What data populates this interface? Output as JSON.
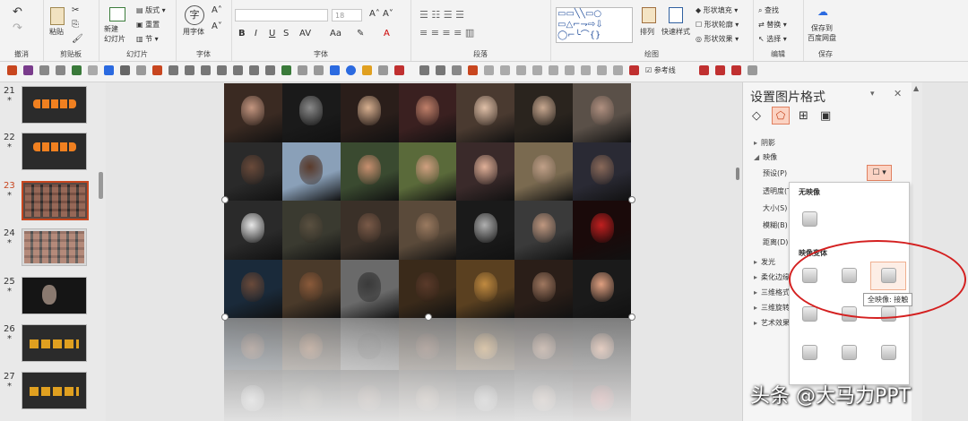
{
  "ribbon": {
    "undo_group": "撤消",
    "clipboard": {
      "label": "剪贴板",
      "paste": "粘贴"
    },
    "slides": {
      "label": "幻灯片",
      "new_slide": "新建\n幻灯片",
      "layout": "版式",
      "reset": "重置",
      "section": "节"
    },
    "font": {
      "label": "字体",
      "use_font": "用字体",
      "font_size": "18"
    },
    "paragraph": {
      "label": "段落"
    },
    "drawing": {
      "label": "绘图",
      "arrange": "排列",
      "quick_styles": "快速样式",
      "shape_fill": "形状填充",
      "shape_outline": "形状轮廓",
      "shape_effects": "形状效果"
    },
    "editing": {
      "label": "编辑",
      "find": "查找",
      "replace": "替换",
      "select": "选择"
    },
    "save": {
      "label": "保存",
      "save_to_cloud": "保存到\n百度网盘"
    }
  },
  "qat": {
    "guides_label": "参考线"
  },
  "slide_list": [
    {
      "num": "21",
      "star": "*"
    },
    {
      "num": "22",
      "star": "*"
    },
    {
      "num": "23",
      "star": "*",
      "selected": true
    },
    {
      "num": "24",
      "star": "*"
    },
    {
      "num": "25",
      "star": "*"
    },
    {
      "num": "26",
      "star": "*"
    },
    {
      "num": "27",
      "star": "*"
    }
  ],
  "pane": {
    "title": "设置图片格式",
    "sections": {
      "shadow": "阴影",
      "reflection": "映像",
      "preset": "预设(P)",
      "transparency": "透明度(T)",
      "size": "大小(S)",
      "blur": "模糊(B)",
      "distance": "距离(D)",
      "glow": "发光",
      "soft_edges": "柔化边缘",
      "three_d_format": "三维格式",
      "three_d_rotation": "三维旋转",
      "artistic_effects": "艺术效果"
    }
  },
  "reflection_dropdown": {
    "no_reflection": "无映像",
    "variations": "映像变体",
    "tooltip": "全映像: 接触"
  },
  "watermark": "头条 @大马力PPT",
  "colors": {
    "accent": "#c8461f",
    "annotation": "#d42020"
  }
}
